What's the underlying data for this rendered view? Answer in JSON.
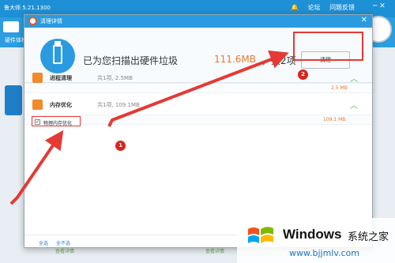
{
  "background_app": {
    "title": "鲁大师 5.21.1300",
    "links": [
      "论坛",
      "问题反馈"
    ],
    "left_label": "硬件体检",
    "bottom_left": "查看详情",
    "bottom_right": "查看详情"
  },
  "dialog": {
    "title": "清理详情",
    "header": {
      "prefix": "已为您扫描出硬件垃圾",
      "size": "111.6MB",
      "suffix": "，共2项"
    },
    "clean_button": "清理",
    "sections": [
      {
        "name": "进程清理",
        "summary": "共1项, 2.5MB",
        "value": "2.5 MB"
      },
      {
        "name": "内存优化",
        "summary": "共1项, 109.1MB",
        "value": "109.1 MB"
      }
    ],
    "checkbox_item": {
      "label": "物理内存优化",
      "checked": true
    },
    "footer": {
      "select_all": "全选",
      "select_none": "全不选"
    }
  },
  "annotations": {
    "marker1": "1",
    "marker2": "2",
    "arrow_color": "#e53935"
  },
  "watermark": {
    "brand": "Windows",
    "cn": "系统之家",
    "url": "www.bjjmlv.com"
  },
  "colors": {
    "accent": "#2a9be0",
    "highlight": "#f07826",
    "annotation": "#d9251c"
  }
}
